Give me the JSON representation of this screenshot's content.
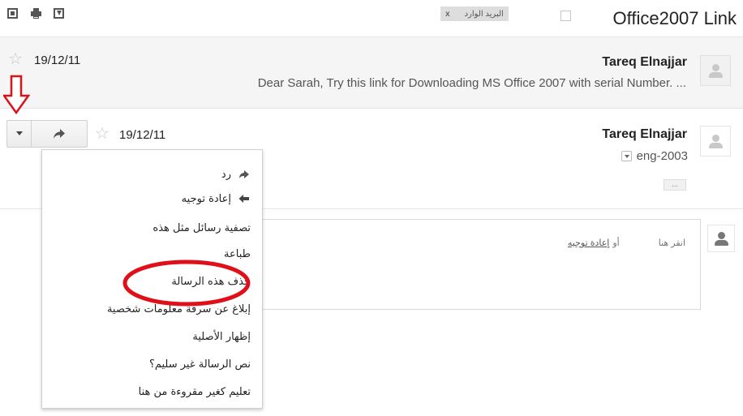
{
  "header": {
    "subject": "Office2007 Link",
    "label_chip": {
      "label": "البريد الوارد",
      "remove": "x"
    },
    "toolbar_icons": [
      "new-window-icon",
      "print-icon",
      "download-icon"
    ]
  },
  "messages": [
    {
      "sender": "Tareq Elnajjar",
      "date": "19/12/11",
      "snippet": "Dear Sarah, Try this link for Downloading MS Office 2007 with serial Number. ...",
      "starred": false
    },
    {
      "sender": "Tareq Elnajjar",
      "date": "19/12/11",
      "to": "eng-2003",
      "starred": false,
      "ellipsis": "..."
    }
  ],
  "reply_hint": {
    "prefix": "انقر هنا",
    "connector": "أو",
    "forward_link": "إعادة توجيه"
  },
  "menu": {
    "items": [
      {
        "label": "رد",
        "icon": "reply-icon"
      },
      {
        "label": "إعادة توجيه",
        "icon": "forward-icon"
      },
      {
        "label": "تصفية رسائل مثل هذه",
        "icon": ""
      },
      {
        "label": "طباعة",
        "icon": ""
      },
      {
        "label": "حذف هذه الرسالة",
        "icon": ""
      },
      {
        "label": "إبلاغ عن سرقة معلومات شخصية",
        "icon": ""
      },
      {
        "label": "إظهار الأصلية",
        "icon": ""
      },
      {
        "label": "نص الرسالة غير سليم؟",
        "icon": ""
      },
      {
        "label": "تعليم كغير مقروءة من هنا",
        "icon": ""
      }
    ]
  },
  "annotation": {
    "color": "#e0101a"
  }
}
